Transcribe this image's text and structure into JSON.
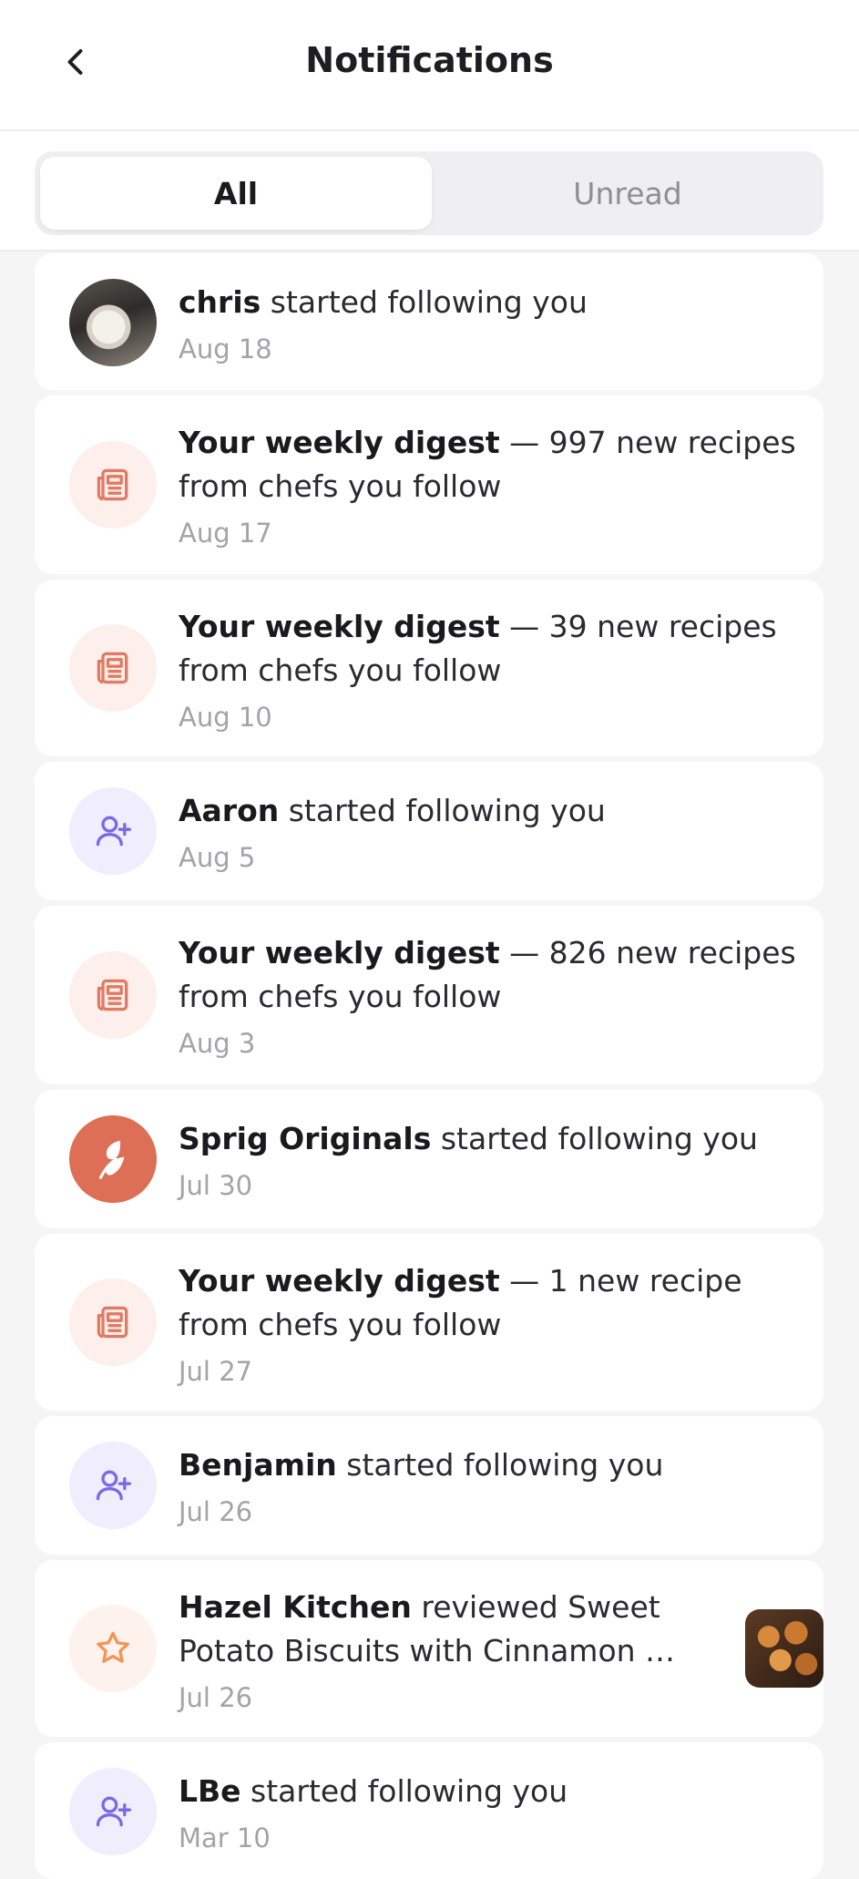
{
  "header": {
    "title": "Notifications",
    "back_icon": "chevron-left-icon"
  },
  "tabs": [
    {
      "label": "All",
      "active": true
    },
    {
      "label": "Unread",
      "active": false
    }
  ],
  "colors": {
    "digest_icon": "#e07a62",
    "follow_icon": "#7b68e8",
    "star_icon": "#f0955a",
    "brand_sprig": "#dc6f55"
  },
  "notifications": [
    {
      "type": "follow",
      "avatar": "user-photo",
      "name": "chris",
      "text": " started following you",
      "date": "Aug 18"
    },
    {
      "type": "digest",
      "avatar": "newspaper-icon",
      "name": "Your weekly digest",
      "text": " — 997 new recipes from chefs you follow",
      "date": "Aug 17"
    },
    {
      "type": "digest",
      "avatar": "newspaper-icon",
      "name": "Your weekly digest",
      "text": " — 39 new recipes from chefs you follow",
      "date": "Aug 10"
    },
    {
      "type": "follow",
      "avatar": "user-plus-icon",
      "name": "Aaron",
      "text": " started following you",
      "date": "Aug 5"
    },
    {
      "type": "digest",
      "avatar": "newspaper-icon",
      "name": "Your weekly digest",
      "text": " — 826 new recipes from chefs you follow",
      "date": "Aug 3"
    },
    {
      "type": "follow",
      "avatar": "sprig-logo",
      "name": "Sprig Originals",
      "text": " started following you",
      "date": "Jul 30"
    },
    {
      "type": "digest",
      "avatar": "newspaper-icon",
      "name": "Your weekly digest",
      "text": " — 1 new recipe from chefs you follow",
      "date": "Jul 27"
    },
    {
      "type": "follow",
      "avatar": "user-plus-icon",
      "name": "Benjamin",
      "text": " started following you",
      "date": "Jul 26"
    },
    {
      "type": "review",
      "avatar": "star-icon",
      "name": "Hazel Kitchen",
      "text": " reviewed Sweet Potato Biscuits with Cinnamon …",
      "date": "Jul 26",
      "thumbnail": "recipe-thumbnail"
    },
    {
      "type": "follow",
      "avatar": "user-plus-icon",
      "name": "LBe",
      "text": " started following you",
      "date": "Mar 10"
    }
  ]
}
